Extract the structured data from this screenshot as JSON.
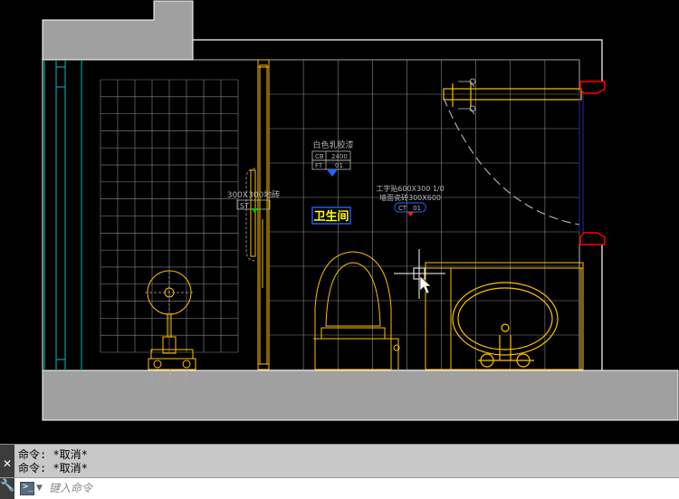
{
  "drawing": {
    "room_label": "卫生间",
    "tile_note_left": {
      "line1": "300X300地砖",
      "tag": "ST"
    },
    "paint_note": {
      "line1": "白色乳胶漆",
      "tag1": "CB",
      "val1": "2400",
      "tag2": "FT",
      "val2": "01"
    },
    "tile_note_right": {
      "line1": "工字贴600X300 1/0",
      "line2": "墙面瓷砖300X600",
      "tag": "CT",
      "val": "01"
    }
  },
  "command_line": {
    "history": [
      "命令: *取消*",
      "命令: *取消*"
    ],
    "placeholder": "键入命令",
    "prompt_icon": ">_",
    "close_icon": "close-icon",
    "settings_icon": "wrench-icon"
  },
  "colors": {
    "background": "#000000",
    "wall_fill": "#a0a0a0",
    "fixture": "#ffc000",
    "grid": "#8a8a8a",
    "glass": "#00a0a0",
    "highlight": "#ff0000",
    "label_fill": "#ffff00",
    "label_border": "#2255ff"
  }
}
